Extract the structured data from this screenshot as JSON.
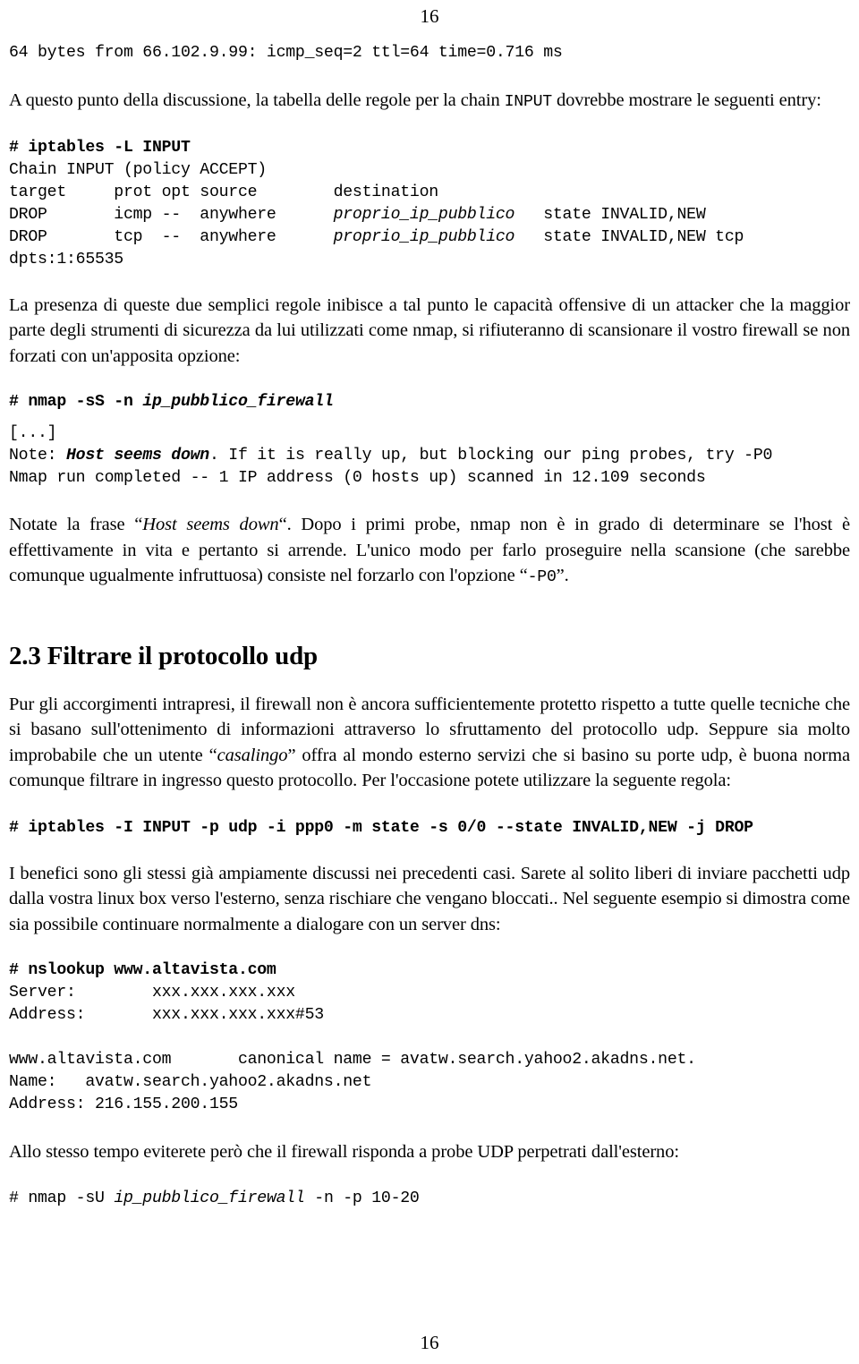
{
  "page": {
    "number_top": "16",
    "number_bottom": "16"
  },
  "blocks": {
    "ping_output": "64 bytes from 66.102.9.99: icmp_seq=2 ttl=64 time=0.716 ms",
    "para_intro_1": "A questo punto della discussione, la tabella delle regole per la chain ",
    "para_intro_inline_code": "INPUT",
    "para_intro_2": " dovrebbe mostrare le seguenti entry:",
    "iptables_listing": {
      "command": "# iptables -L INPUT",
      "chain_line": "Chain INPUT (policy ACCEPT)",
      "header_row": "target     prot opt source        destination",
      "row1_pre": "DROP       icmp --  anywhere      ",
      "row1_dest": "proprio_ip_pubblico",
      "row1_post": "   state INVALID,NEW",
      "row2_pre": "DROP       tcp  --  anywhere      ",
      "row2_dest": "proprio_ip_pubblico",
      "row2_post": "   state INVALID,NEW tcp",
      "row2_wrap": "dpts:1:65535"
    },
    "para_nmap_intro": "La presenza di queste due semplici regole inibisce a tal punto le capacità offensive di un attacker che la maggior parte degli strumenti di sicurezza da lui utilizzati come nmap, si rifiuteranno di scansionare il vostro firewall se non forzati con un'apposita opzione:",
    "nmap_command_pre": "# nmap -sS -n ",
    "nmap_command_arg": "ip_pubblico_firewall",
    "nmap_output": {
      "ellipsis": "[...]",
      "note_label": "Note: ",
      "note_bold": "Host seems down",
      "note_rest": ". If it is really up, but blocking our ping probes, try -P0",
      "run_line": "Nmap run completed -- 1 IP address (0 hosts up) scanned in 12.109 seconds"
    },
    "para_host_down_a": "Notate la frase “",
    "para_host_down_italic": "Host seems down",
    "para_host_down_b": "“. Dopo i primi probe, nmap non è in grado di determinare se l'host è effettivamente in vita e pertanto si arrende. L'unico modo per farlo proseguire nella scansione (che sarebbe comunque ugualmente infruttuosa) consiste nel forzarlo con l'opzione “",
    "para_host_down_code": "-P0",
    "para_host_down_c": "”.",
    "section_heading": "2.3 Filtrare il protocollo udp",
    "para_udp_a": "Pur gli accorgimenti intrapresi, il firewall non è ancora sufficientemente protetto rispetto a tutte quelle tecniche che si basano sull'ottenimento di informazioni attraverso lo sfruttamento del protocollo udp. Seppure sia molto improbabile che un utente “",
    "para_udp_italic": "casalingo",
    "para_udp_b": "” offra al mondo esterno servizi che si basino su porte udp, è buona norma comunque filtrare in ingresso questo protocollo. Per l'occasione potete utilizzare la seguente regola:",
    "iptables_udp_rule": "# iptables -I INPUT -p udp -i ppp0 -m state -s 0/0 --state INVALID,NEW -j DROP",
    "para_benefici": "I benefici sono gli stessi già ampiamente discussi nei precedenti casi. Sarete al solito liberi di inviare pacchetti udp dalla vostra linux box verso l'esterno, senza rischiare che vengano bloccati.. Nel seguente esempio si dimostra come sia possibile continuare normalmente a dialogare con un server dns:",
    "nslookup": {
      "command": "# nslookup www.altavista.com",
      "server_line": "Server:        xxx.xxx.xxx.xxx",
      "address_line": "Address:       xxx.xxx.xxx.xxx#53",
      "blank": "",
      "canonical_line": "www.altavista.com       canonical name = avatw.search.yahoo2.akadns.net.",
      "name_line": "Name:   avatw.search.yahoo2.akadns.net",
      "address2_line": "Address: 216.155.200.155"
    },
    "para_probe_udp": "Allo stesso tempo eviterete però che il firewall risponda a probe UDP perpetrati dall'esterno:",
    "nmap_udp_pre": "# nmap -sU ",
    "nmap_udp_arg": "ip_pubblico_firewall",
    "nmap_udp_post": " -n -p 10-20"
  }
}
